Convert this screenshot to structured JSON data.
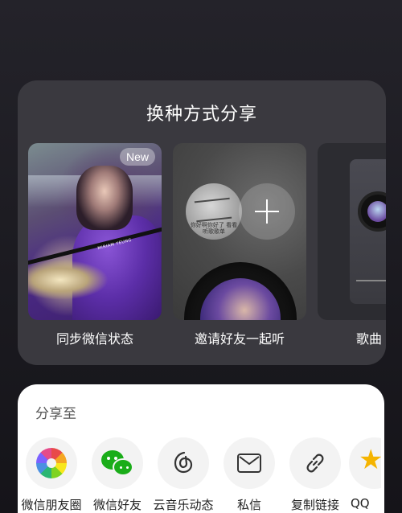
{
  "panel": {
    "title": "换种方式分享",
    "cards": [
      {
        "label": "同步微信状态",
        "badge": "New",
        "art_text": "MIRIAM YEUNG"
      },
      {
        "label": "邀请好友一起听",
        "avatar_text": "你好啊你好了 看看听歌歌单"
      },
      {
        "label": "歌曲"
      }
    ]
  },
  "share": {
    "title": "分享至",
    "targets": [
      {
        "label": "微信朋友圈",
        "icon": "wechat-moments-icon"
      },
      {
        "label": "微信好友",
        "icon": "wechat-icon"
      },
      {
        "label": "云音乐动态",
        "icon": "cloud-music-icon"
      },
      {
        "label": "私信",
        "icon": "mail-icon"
      },
      {
        "label": "复制链接",
        "icon": "link-icon"
      },
      {
        "label": "QQ",
        "icon": "qq-star-icon"
      }
    ]
  },
  "colors": {
    "background": "#1e1d23",
    "panel": "#3a393f",
    "sheet": "#ffffff",
    "wechat_green": "#1aad19",
    "qq_yellow": "#f5b400"
  }
}
